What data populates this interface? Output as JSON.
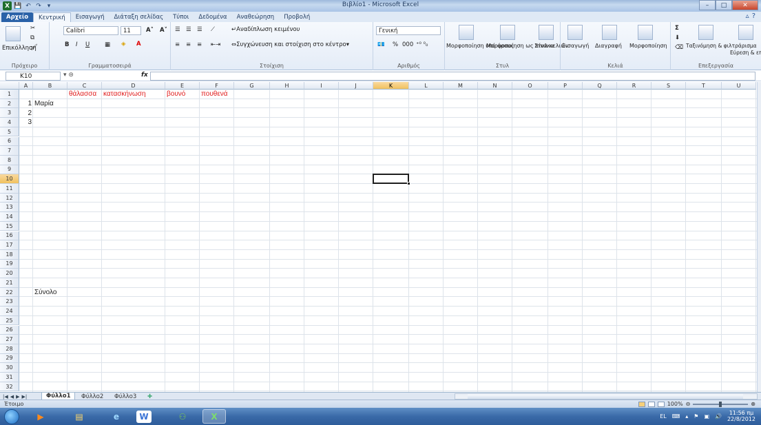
{
  "window": {
    "title": "Βιβλίο1 - Microsoft Excel",
    "logo": "X",
    "min": "–",
    "max": "□",
    "close": "✕"
  },
  "qat": {
    "save": "💾",
    "undo": "↶",
    "redo": "↷",
    "customize": "▾"
  },
  "ribbon_tabs": [
    "Αρχείο",
    "Κεντρική",
    "Εισαγωγή",
    "Διάταξη σελίδας",
    "Τύποι",
    "Δεδομένα",
    "Αναθεώρηση",
    "Προβολή"
  ],
  "ribbon": {
    "clipboard": {
      "paste": "Επικόλληση",
      "label": "Πρόχειρο"
    },
    "font": {
      "name": "Calibri",
      "size": "11",
      "bold": "B",
      "italic": "I",
      "underline": "U",
      "grow": "A˄",
      "shrink": "A˅",
      "label": "Γραμματοσειρά"
    },
    "alignment": {
      "wrap": "Αναδίπλωση κειμένου",
      "merge": "Συγχώνευση και στοίχιση στο κέντρο",
      "label": "Στοίχιση"
    },
    "number": {
      "format": "Γενική",
      "percent": "%",
      "thousands": "000",
      "label": "Αριθμός"
    },
    "styles": {
      "cond": "Μορφοποίηση υπό όρους",
      "table": "Μορφοποίηση ως πίνακα",
      "cell": "Στυλ κελιών",
      "label": "Στυλ"
    },
    "cells": {
      "insert": "Εισαγωγή",
      "delete": "Διαγραφή",
      "format": "Μορφοποίηση",
      "label": "Κελιά"
    },
    "editing": {
      "sort": "Ταξινόμηση & φιλτράρισμα",
      "find": "Εύρεση & επιλογή",
      "sigma": "Σ",
      "label": "Επεξεργασία"
    }
  },
  "formula_bar": {
    "name_box": "K10",
    "fx": "fx",
    "value": ""
  },
  "columns": [
    "A",
    "B",
    "C",
    "D",
    "E",
    "F",
    "G",
    "H",
    "I",
    "J",
    "K",
    "L",
    "M",
    "N",
    "O",
    "P",
    "Q",
    "R",
    "S",
    "T",
    "U"
  ],
  "rows": [
    "1",
    "2",
    "3",
    "4",
    "5",
    "6",
    "7",
    "8",
    "9",
    "10",
    "11",
    "12",
    "13",
    "14",
    "15",
    "16",
    "17",
    "18",
    "19",
    "20",
    "21",
    "22",
    "23",
    "24",
    "25",
    "26",
    "27",
    "28",
    "29",
    "30",
    "31",
    "32"
  ],
  "cells": {
    "C1": "θάλασσα",
    "D1": "κατασκήνωση",
    "E1": "βουνό",
    "F1": "πουθενά",
    "A2": "1",
    "B2": "Μαρία",
    "A3": "2",
    "A4": "3",
    "B22": "Σύνολο"
  },
  "sheets": [
    "Φύλλο1",
    "Φύλλο2",
    "Φύλλο3"
  ],
  "status": {
    "text": "Έτοιμο",
    "zoom": "100%"
  },
  "taskbar": {
    "lang": "EL",
    "time": "11:56 πμ",
    "date": "22/8/2012"
  },
  "colors": {
    "accent": "#2a62a8",
    "red_text": "#e01b1b",
    "selected_header": "#f1c15f"
  }
}
